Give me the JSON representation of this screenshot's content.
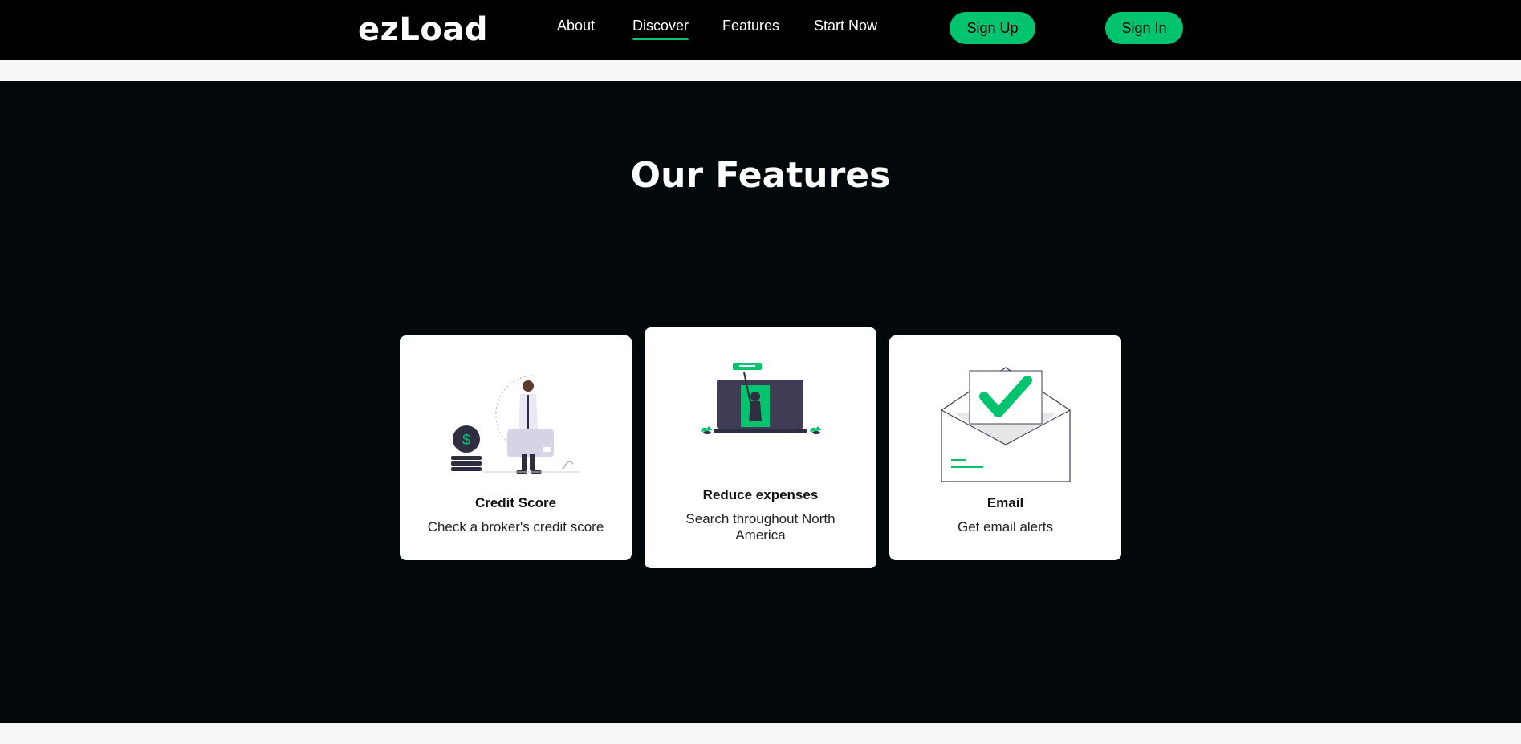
{
  "brand": {
    "logo": "ezLoad",
    "accent": "#03c46e",
    "dark": "#03090a"
  },
  "nav": {
    "links": [
      "About",
      "Discover",
      "Features",
      "Start Now"
    ],
    "active": "Discover",
    "signup_label": "Sign Up",
    "signin_label": "Sign In"
  },
  "features": {
    "title": "Our Features",
    "cards": [
      {
        "title": "Credit Score",
        "desc": "Check a broker's credit score",
        "icon": "credit-score-illustration"
      },
      {
        "title": "Reduce expenses",
        "desc": "Search throughout North America",
        "icon": "laptop-search-illustration"
      },
      {
        "title": "Email",
        "desc": "Get email alerts",
        "icon": "email-check-illustration"
      }
    ]
  }
}
